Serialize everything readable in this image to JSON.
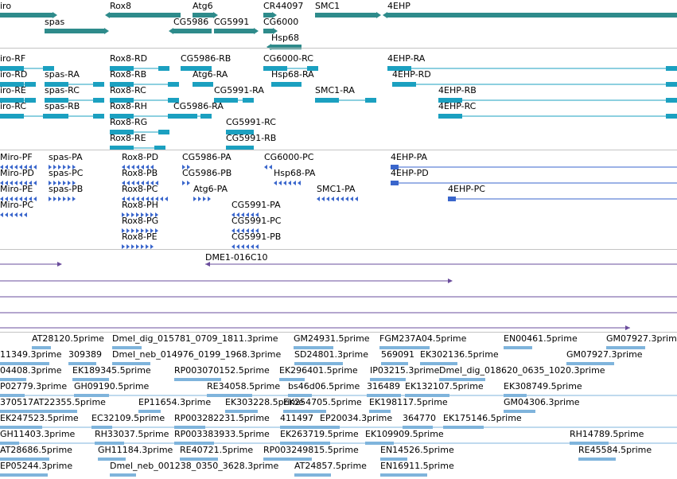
{
  "colors": {
    "gene": "#2e8b8b",
    "transcript": "#1ba0c0",
    "cds": "#3a66cc",
    "clone": "#6a4c9c",
    "est": "#7fb4dc",
    "separator": "#c4c4c4"
  },
  "tracks": {
    "genes": [
      {
        "label": "iro"
      },
      {
        "label": "spas"
      },
      {
        "label": "Rox8"
      },
      {
        "label": "Atg6"
      },
      {
        "label": "CG5986"
      },
      {
        "label": "CG5991"
      },
      {
        "label": "CR44097"
      },
      {
        "label": "CG6000"
      },
      {
        "label": "Hsp68"
      },
      {
        "label": "SMC1"
      },
      {
        "label": "4EHP"
      }
    ],
    "transcripts": [
      {
        "label": "iro-RF"
      },
      {
        "label": "Rox8-RD"
      },
      {
        "label": "CG5986-RB"
      },
      {
        "label": "CG6000-RC"
      },
      {
        "label": "4EHP-RA"
      },
      {
        "label": "iro-RD"
      },
      {
        "label": "spas-RA"
      },
      {
        "label": "Rox8-RB"
      },
      {
        "label": "Atg6-RA"
      },
      {
        "label": "Hsp68-RA"
      },
      {
        "label": "4EHP-RD"
      },
      {
        "label": "iro-RE"
      },
      {
        "label": "spas-RC"
      },
      {
        "label": "Rox8-RC"
      },
      {
        "label": "CG5991-RA"
      },
      {
        "label": "SMC1-RA"
      },
      {
        "label": "4EHP-RB"
      },
      {
        "label": "iro-RC"
      },
      {
        "label": "spas-RB"
      },
      {
        "label": "Rox8-RH"
      },
      {
        "label": "CG5986-RA"
      },
      {
        "label": "4EHP-RC"
      },
      {
        "label": "Rox8-RG"
      },
      {
        "label": "CG5991-RC"
      },
      {
        "label": "Rox8-RE"
      },
      {
        "label": "CG5991-RB"
      }
    ],
    "proteins": [
      {
        "label": "Miro-PF"
      },
      {
        "label": "spas-PA"
      },
      {
        "label": "Rox8-PD"
      },
      {
        "label": "CG5986-PA"
      },
      {
        "label": "CG6000-PC"
      },
      {
        "label": "4EHP-PA"
      },
      {
        "label": "Miro-PD"
      },
      {
        "label": "spas-PC"
      },
      {
        "label": "Rox8-PB"
      },
      {
        "label": "CG5986-PB"
      },
      {
        "label": "Hsp68-PA"
      },
      {
        "label": "4EHP-PD"
      },
      {
        "label": "Miro-PE"
      },
      {
        "label": "spas-PB"
      },
      {
        "label": "Rox8-PC"
      },
      {
        "label": "Atg6-PA"
      },
      {
        "label": "SMC1-PA"
      },
      {
        "label": "4EHP-PC"
      },
      {
        "label": "Miro-PC"
      },
      {
        "label": "Rox8-PH"
      },
      {
        "label": "CG5991-PA"
      },
      {
        "label": "Rox8-PG"
      },
      {
        "label": "CG5991-PC"
      },
      {
        "label": "Rox8-PE"
      },
      {
        "label": "CG5991-PB"
      }
    ],
    "clones": [
      {
        "label": "DME1-016C10"
      }
    ],
    "ests": [
      {
        "label": "AT28120.5prime"
      },
      {
        "label": "Dmel_dig_015781_0709_1811.3prime"
      },
      {
        "label": "GM24931.5prime"
      },
      {
        "label": "FGM237A04.5prime"
      },
      {
        "label": "EN00461.5prime"
      },
      {
        "label": "GM07927.3prime"
      },
      {
        "label": "11349.3prime"
      },
      {
        "label": "309389"
      },
      {
        "label": "Dmel_neb_014976_0199_1968.3prime"
      },
      {
        "label": "SD24801.3prime"
      },
      {
        "label": "569091"
      },
      {
        "label": "EK302136.5prime"
      },
      {
        "label": "GM07927.3prime"
      },
      {
        "label": "04408.3prime"
      },
      {
        "label": "EK189345.5prime"
      },
      {
        "label": "RP003070152.5prime"
      },
      {
        "label": "EK296401.5prime"
      },
      {
        "label": "IP03215.3prime"
      },
      {
        "label": "Dmel_dig_018620_0635_1020.3prime"
      },
      {
        "label": "P02779.3prime"
      },
      {
        "label": "GH09190.5prime"
      },
      {
        "label": "RE34058.5prime"
      },
      {
        "label": "bs46d06.5prime"
      },
      {
        "label": "316489"
      },
      {
        "label": "EK132107.5prime"
      },
      {
        "label": "EK308749.5prime"
      },
      {
        "label": "370517"
      },
      {
        "label": "AT22355.5prime"
      },
      {
        "label": "EP11654.3prime"
      },
      {
        "label": "EK303228.5prime"
      },
      {
        "label": "EK254705.5prime"
      },
      {
        "label": "EK198117.5prime"
      },
      {
        "label": "GM04306.3prime"
      },
      {
        "label": "EK247523.5prime"
      },
      {
        "label": "EC32109.5prime"
      },
      {
        "label": "RP003282231.5prime"
      },
      {
        "label": "411497"
      },
      {
        "label": "EP20034.3prime"
      },
      {
        "label": "364770"
      },
      {
        "label": "EK175146.5prime"
      },
      {
        "label": "GH11403.3prime"
      },
      {
        "label": "RH33037.5prime"
      },
      {
        "label": "RP003383933.5prime"
      },
      {
        "label": "EK263719.5prime"
      },
      {
        "label": "EK109909.5prime"
      },
      {
        "label": "RH14789.5prime"
      },
      {
        "label": "AT28686.5prime"
      },
      {
        "label": "GH11184.3prime"
      },
      {
        "label": "RE40721.5prime"
      },
      {
        "label": "RP003249815.5prime"
      },
      {
        "label": "EN14526.5prime"
      },
      {
        "label": "RE45584.5prime"
      },
      {
        "label": "EP05244.3prime"
      },
      {
        "label": "Dmel_neb_001238_0350_3628.3prime"
      },
      {
        "label": "AT24857.5prime"
      },
      {
        "label": "EN16911.5prime"
      }
    ]
  }
}
